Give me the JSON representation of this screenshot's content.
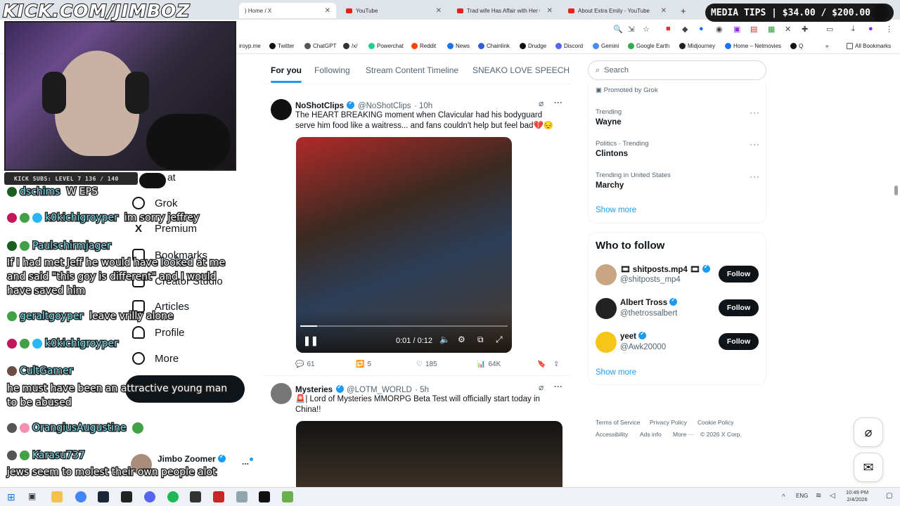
{
  "overlay": {
    "stream_url": "KICK.COM/JIMBOZ",
    "media_tips": "MEDIA TIPS | $34.00 / $200.00",
    "kick_subs": "KICK SUBS: LEVEL 7 136 / 140"
  },
  "browser": {
    "tabs": [
      {
        "label": ") Home / X",
        "active": true
      },
      {
        "label": "YouTube"
      },
      {
        "label": "Trad wife Has Affair with Her Co"
      },
      {
        "label": "About Extra Emily - YouTube"
      }
    ],
    "new_tab_label": "+",
    "bookmarks": [
      "iroyp.me",
      "Twitter",
      "ChatGPT",
      "/x/",
      "Powerchat",
      "Reddit",
      "News",
      "Chainlink",
      "Drudge",
      "Discord",
      "Gemini",
      "Google Earth",
      "Midjourney",
      "Home – Netmovies",
      "Q"
    ],
    "all_bookmarks": "All Bookmarks"
  },
  "chat": [
    {
      "user": "dschims",
      "msg": "W EPS"
    },
    {
      "user": "k0kichigroyper",
      "msg": "im sorry jeffrey"
    },
    {
      "user": "Paulschirmjager",
      "msg": ""
    },
    {
      "user": "",
      "msg": "If I had met Jeff he would have looked at me and said \"this goy is different\" and I would have saved him"
    },
    {
      "user": "geraltgoyper",
      "msg": "leave vrilly alone"
    },
    {
      "user": "k0kichigroyper",
      "msg": ""
    },
    {
      "user": "CultGamer",
      "msg": ""
    },
    {
      "user": "",
      "msg": "he must have been an attractive young man to be abused"
    },
    {
      "user": "OrangiusAugustine",
      "msg": ""
    },
    {
      "user": "Karasu737",
      "msg": ""
    },
    {
      "user": "",
      "msg": "jews seem to molest their own people alot"
    }
  ],
  "sidenav": {
    "items": [
      "at",
      "Grok",
      "Premium",
      "Bookmarks",
      "Creator Studio",
      "Articles",
      "Profile",
      "More"
    ],
    "account_name": "Jimbo Zoomer",
    "more_dots": "..."
  },
  "feed": {
    "tabs": [
      "For you",
      "Following",
      "Stream Content Timeline",
      "SNEAKO LOVE SPEECH"
    ],
    "tweets": [
      {
        "name": "NoShotClips",
        "handle": "@NoShotClips",
        "time": "· 10h",
        "text": "The HEART BREAKING moment when Clavicular had his bodyguard serve him food like a waitress... and fans couldn't help but feel bad💔😔",
        "video_time": "0:01 / 0:12",
        "replies": "61",
        "reposts": "5",
        "likes": "185",
        "views": "64K"
      },
      {
        "name": "Mysteries",
        "handle": "@LOTM_WORLD",
        "time": "· 5h",
        "text": "🚨| Lord of Mysteries MMORPG Beta Test will officially start today in China!!"
      }
    ]
  },
  "sidebar": {
    "search_placeholder": "Search",
    "promoted": "Promoted by Grok",
    "trends": [
      {
        "context": "Trending",
        "topic": "Wayne"
      },
      {
        "context": "Politics · Trending",
        "topic": "Clintons"
      },
      {
        "context": "Trending in United States",
        "topic": "Marchy"
      }
    ],
    "show_more": "Show more",
    "who_to_follow_title": "Who to follow",
    "who_to_follow": [
      {
        "name": "🎞 shitposts.mp4 🎞",
        "handle": "@shitposts_mp4"
      },
      {
        "name": "Albert Tross",
        "handle": "@thetrossalbert"
      },
      {
        "name": "yeet",
        "handle": "@Awk20000"
      }
    ],
    "follow_label": "Follow",
    "footer": [
      "Terms of Service",
      "Privacy Policy",
      "Cookie Policy",
      "Accessibility",
      "Ads info",
      "More ···",
      "© 2026 X Corp."
    ]
  },
  "taskbar": {
    "lang": "ENG",
    "time": "10:49 PM",
    "date": "2/4/2026"
  }
}
